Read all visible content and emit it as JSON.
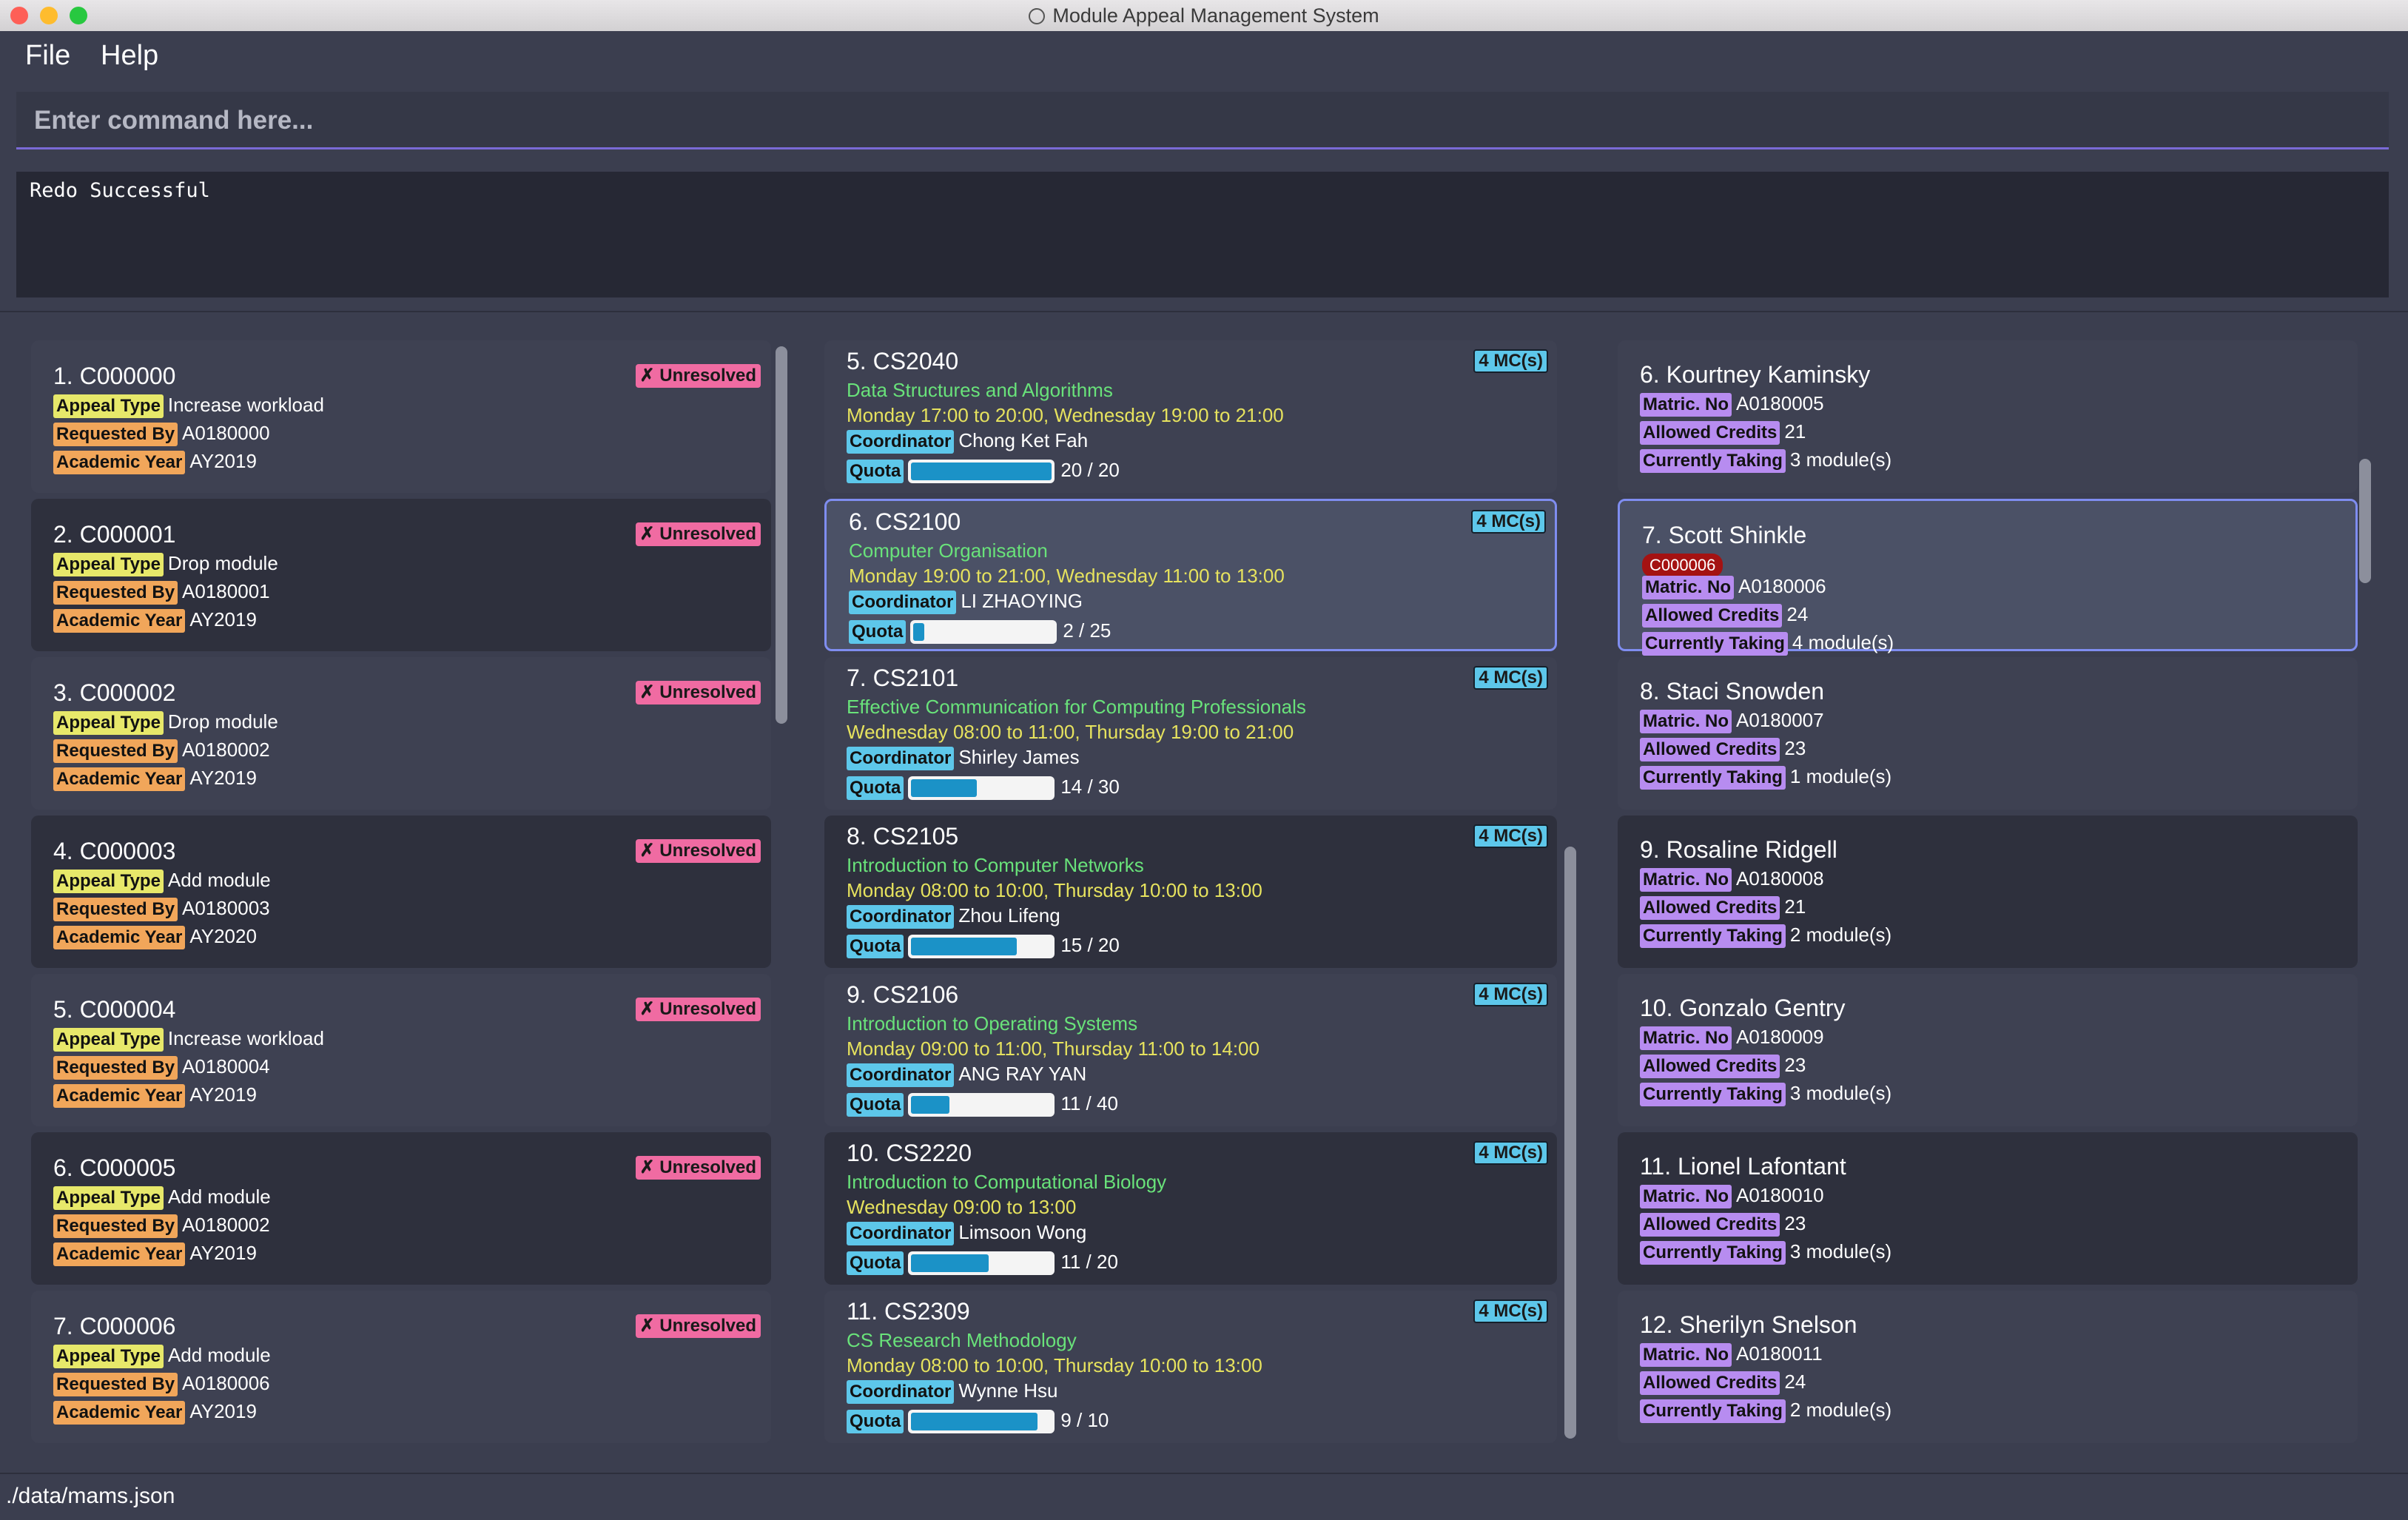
{
  "window": {
    "title": "Module Appeal Management System"
  },
  "menu": {
    "file": "File",
    "help": "Help"
  },
  "command": {
    "placeholder": "Enter command here..."
  },
  "result": {
    "text": "Redo Successful"
  },
  "status": {
    "path": "./data/mams.json"
  },
  "labels": {
    "appeal_type": "Appeal Type",
    "requested_by": "Requested By",
    "academic_year": "Academic Year",
    "coordinator": "Coordinator",
    "quota": "Quota",
    "matric": "Matric. No",
    "allowed": "Allowed Credits",
    "taking": "Currently Taking",
    "modules_suffix": "module(s)"
  },
  "appeals": [
    {
      "index": "1.",
      "id": "C000000",
      "status": "✗ Unresolved",
      "type": "Increase workload",
      "by": "A0180000",
      "year": "AY2019"
    },
    {
      "index": "2.",
      "id": "C000001",
      "status": "✗ Unresolved",
      "type": "Drop module",
      "by": "A0180001",
      "year": "AY2019"
    },
    {
      "index": "3.",
      "id": "C000002",
      "status": "✗ Unresolved",
      "type": "Drop module",
      "by": "A0180002",
      "year": "AY2019"
    },
    {
      "index": "4.",
      "id": "C000003",
      "status": "✗ Unresolved",
      "type": "Add module",
      "by": "A0180003",
      "year": "AY2020"
    },
    {
      "index": "5.",
      "id": "C000004",
      "status": "✗ Unresolved",
      "type": "Increase workload",
      "by": "A0180004",
      "year": "AY2019"
    },
    {
      "index": "6.",
      "id": "C000005",
      "status": "✗ Unresolved",
      "type": "Add module",
      "by": "A0180002",
      "year": "AY2019"
    },
    {
      "index": "7.",
      "id": "C000006",
      "status": "✗ Unresolved",
      "type": "Add module",
      "by": "A0180006",
      "year": "AY2019"
    }
  ],
  "modules": [
    {
      "index": "5.",
      "code": "CS2040",
      "mc": "4 MC(s)",
      "name": "Data Structures and Algorithms",
      "time": "Monday 17:00 to 20:00, Wednesday 19:00 to 21:00",
      "coordinator": "Chong Ket Fah",
      "quota": "20 / 20",
      "fill": 1.0
    },
    {
      "index": "6.",
      "code": "CS2100",
      "mc": "4 MC(s)",
      "name": "Computer Organisation",
      "time": "Monday 19:00 to 21:00, Wednesday 11:00 to 13:00",
      "coordinator": "LI ZHAOYING",
      "quota": "2 / 25",
      "fill": 0.08
    },
    {
      "index": "7.",
      "code": "CS2101",
      "mc": "4 MC(s)",
      "name": "Effective Communication for Computing Professionals",
      "time": "Wednesday 08:00 to 11:00, Thursday 19:00 to 21:00",
      "coordinator": "Shirley James",
      "quota": "14 / 30",
      "fill": 0.467
    },
    {
      "index": "8.",
      "code": "CS2105",
      "mc": "4 MC(s)",
      "name": "Introduction to Computer Networks",
      "time": "Monday 08:00 to 10:00, Thursday 10:00 to 13:00",
      "coordinator": "Zhou Lifeng",
      "quota": "15 / 20",
      "fill": 0.75
    },
    {
      "index": "9.",
      "code": "CS2106",
      "mc": "4 MC(s)",
      "name": "Introduction to Operating Systems",
      "time": "Monday 09:00 to 11:00, Thursday 11:00 to 14:00",
      "coordinator": "ANG RAY YAN",
      "quota": "11 / 40",
      "fill": 0.275
    },
    {
      "index": "10.",
      "code": "CS2220",
      "mc": "4 MC(s)",
      "name": "Introduction to Computational Biology",
      "time": "Wednesday 09:00 to 13:00",
      "coordinator": "Limsoon Wong",
      "quota": "11 / 20",
      "fill": 0.55
    },
    {
      "index": "11.",
      "code": "CS2309",
      "mc": "4 MC(s)",
      "name": "CS Research Methodology",
      "time": "Monday 08:00 to 10:00, Thursday 10:00 to 13:00",
      "coordinator": "Wynne Hsu",
      "quota": "9 / 10",
      "fill": 0.9
    }
  ],
  "students": [
    {
      "index": "6.",
      "name": "Kourtney Kaminsky",
      "matric": "A0180005",
      "credits": "21",
      "taking": "3"
    },
    {
      "index": "7.",
      "name": "Scott Shinkle",
      "tag": "C000006",
      "matric": "A0180006",
      "credits": "24",
      "taking": "4"
    },
    {
      "index": "8.",
      "name": "Staci Snowden",
      "matric": "A0180007",
      "credits": "23",
      "taking": "1"
    },
    {
      "index": "9.",
      "name": "Rosaline Ridgell",
      "matric": "A0180008",
      "credits": "21",
      "taking": "2"
    },
    {
      "index": "10.",
      "name": "Gonzalo Gentry",
      "matric": "A0180009",
      "credits": "23",
      "taking": "3"
    },
    {
      "index": "11.",
      "name": "Lionel Lafontant",
      "matric": "A0180010",
      "credits": "23",
      "taking": "3"
    },
    {
      "index": "12.",
      "name": "Sherilyn Snelson",
      "matric": "A0180011",
      "credits": "24",
      "taking": "2"
    }
  ]
}
